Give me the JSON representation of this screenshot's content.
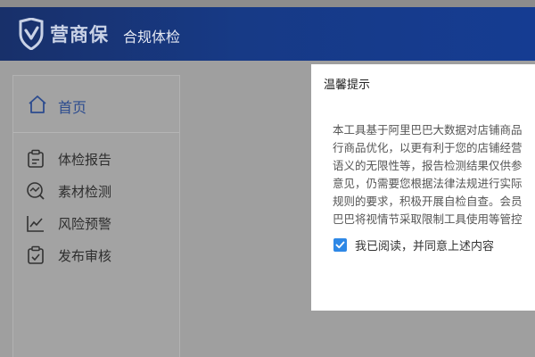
{
  "header": {
    "logo_text": "营商保",
    "title": "合规体检"
  },
  "sidebar": {
    "home": {
      "label": "首页",
      "icon": "home-icon"
    },
    "items": [
      {
        "label": "体检报告",
        "icon": "clipboard-icon"
      },
      {
        "label": "素材检测",
        "icon": "search-chart-icon"
      },
      {
        "label": "风险预警",
        "icon": "trend-chart-icon"
      },
      {
        "label": "发布审核",
        "icon": "checklist-icon"
      }
    ]
  },
  "modal": {
    "title": "温馨提示",
    "lines": [
      "本工具基于阿里巴巴大数据对店铺商品",
      "行商品优化，以更有利于您的店铺经营",
      "语义的无限性等，报告检测结果仅供参",
      "意见，仍需要您根据法律法规进行实际",
      "规则的要求，积极开展自检自查。会员",
      "巴巴将视情节采取限制工具使用等管控"
    ],
    "agree": {
      "label": "我已阅读，并同意上述内容",
      "checked": true
    }
  },
  "colors": {
    "header_blue": "#153c92",
    "accent_blue": "#2e88e6",
    "overlay_gray": "#9f9f9f"
  }
}
